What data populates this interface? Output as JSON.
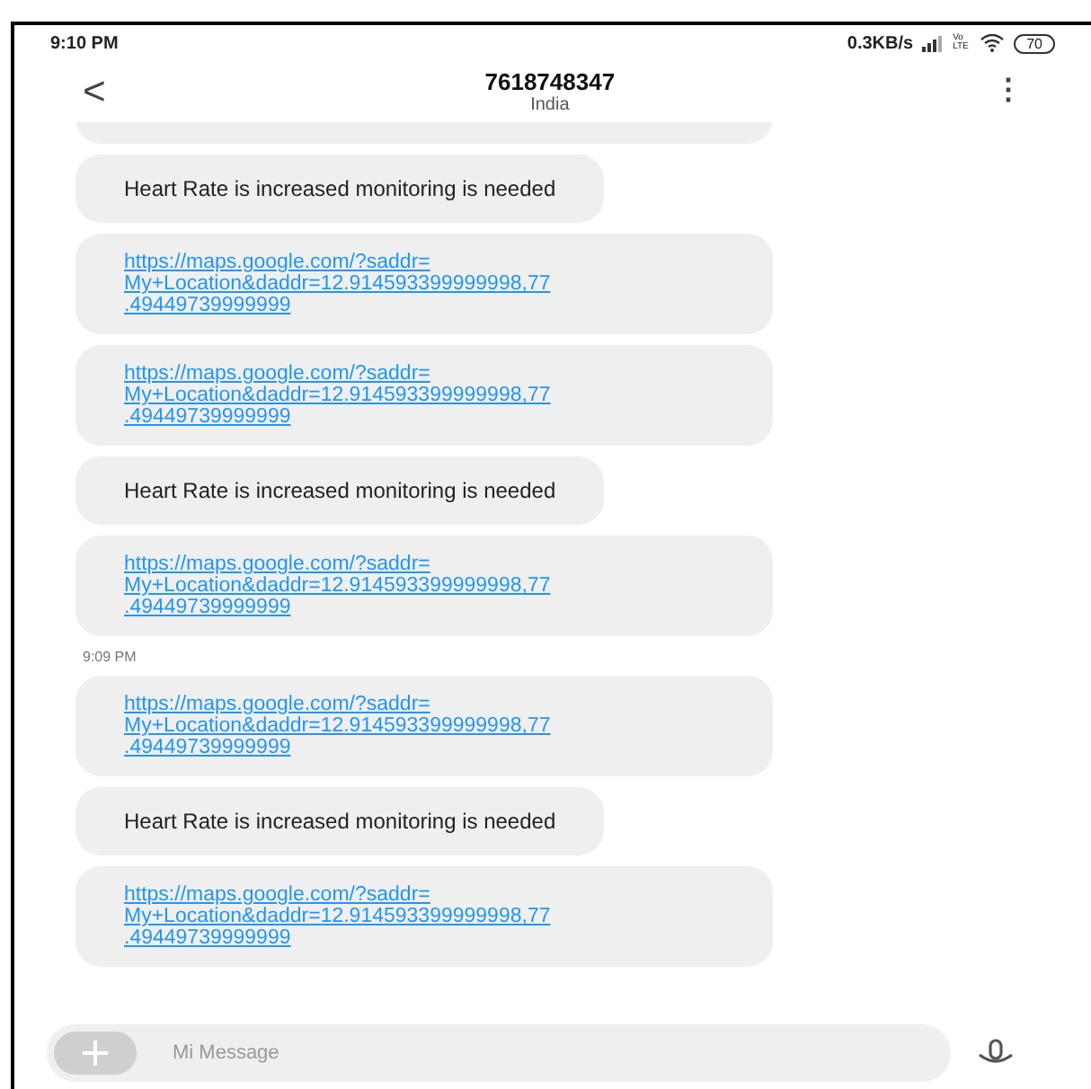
{
  "status_bar": {
    "time": "9:10 PM",
    "speed": "0.3KB/s",
    "network_label": "Vo LTE",
    "battery": "70"
  },
  "header": {
    "back": "<",
    "title": "7618748347",
    "subtitle": "India",
    "menu": "⋮"
  },
  "messages": [
    {
      "kind": "text",
      "text": "Heart Rate is increased monitoring is needed"
    },
    {
      "kind": "link",
      "lines": [
        "https://maps.google.com/?saddr=",
        "My+Location&daddr=12.914593399999998,77",
        ".49449739999999"
      ]
    },
    {
      "kind": "link",
      "lines": [
        "https://maps.google.com/?saddr=",
        "My+Location&daddr=12.914593399999998,77",
        ".49449739999999"
      ]
    },
    {
      "kind": "text",
      "text": "Heart Rate is increased monitoring is needed"
    },
    {
      "kind": "link",
      "lines": [
        "https://maps.google.com/?saddr=",
        "My+Location&daddr=12.914593399999998,77",
        ".49449739999999"
      ]
    },
    {
      "kind": "time",
      "text": "9:09 PM"
    },
    {
      "kind": "link",
      "lines": [
        "https://maps.google.com/?saddr=",
        "My+Location&daddr=12.914593399999998,77",
        ".49449739999999"
      ]
    },
    {
      "kind": "text",
      "text": "Heart Rate is increased monitoring is needed"
    },
    {
      "kind": "link",
      "lines": [
        "https://maps.google.com/?saddr=",
        "My+Location&daddr=12.914593399999998,77",
        ".49449739999999"
      ]
    }
  ],
  "composer": {
    "placeholder": "Mi Message"
  }
}
